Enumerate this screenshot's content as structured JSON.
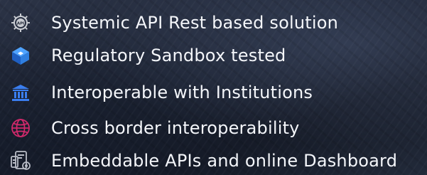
{
  "features": [
    {
      "icon": "api-gear-icon",
      "label": "Systemic API Rest based solution"
    },
    {
      "icon": "sandbox-cube-icon",
      "label": "Regulatory Sandbox tested"
    },
    {
      "icon": "institution-bank-icon",
      "label": "Interoperable with Institutions"
    },
    {
      "icon": "globe-icon",
      "label": "Cross border interoperability"
    },
    {
      "icon": "dashboard-devices-icon",
      "label": "Embeddable APIs and online Dashboard"
    }
  ],
  "colors": {
    "text": "#f4f6fa",
    "gear": "#c9ccd2",
    "sandbox_blue": "#2f7fe0",
    "bank_blue": "#3a7ef0",
    "globe_pink": "#d0296b",
    "dashboard_gray": "#b8bcc6"
  }
}
